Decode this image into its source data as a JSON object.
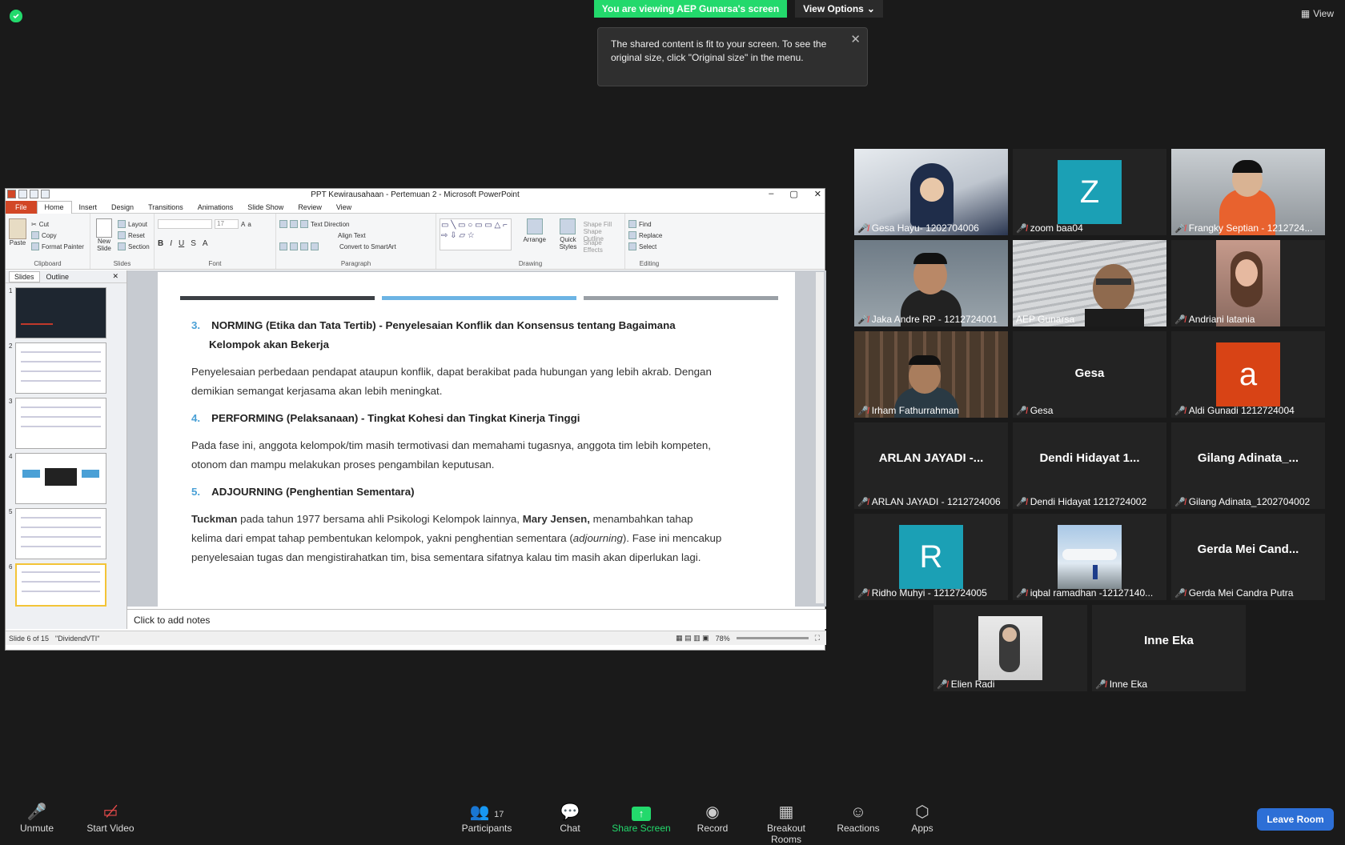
{
  "banner": {
    "viewing": "You are viewing AEP Gunarsa's screen",
    "view_options": "View Options"
  },
  "tooltip": {
    "text": "The shared content is fit to your screen. To see the original size, click \"Original size\" in the menu."
  },
  "top_right": {
    "view": "View"
  },
  "ppt": {
    "title": "PPT Kewirausahaan - Pertemuan 2  -  Microsoft PowerPoint",
    "tabs": [
      "File",
      "Home",
      "Insert",
      "Design",
      "Transitions",
      "Animations",
      "Slide Show",
      "Review",
      "View"
    ],
    "clipboard": {
      "paste": "Paste",
      "cut": "Cut",
      "copy": "Copy",
      "format_painter": "Format Painter",
      "label": "Clipboard"
    },
    "slides": {
      "new_slide": "New Slide",
      "layout": "Layout",
      "reset": "Reset",
      "section": "Section",
      "label": "Slides"
    },
    "font": {
      "size": "17",
      "label": "Font"
    },
    "paragraph": {
      "text_direction": "Text Direction",
      "align_text": "Align Text",
      "smartart": "Convert to SmartArt",
      "label": "Paragraph"
    },
    "drawing": {
      "arrange": "Arrange",
      "quick_styles": "Quick Styles",
      "shape_fill": "Shape Fill",
      "shape_outline": "Shape Outline",
      "shape_effects": "Shape Effects",
      "label": "Drawing"
    },
    "editing": {
      "find": "Find",
      "replace": "Replace",
      "select": "Select",
      "label": "Editing"
    },
    "pane_tabs": {
      "slides": "Slides",
      "outline": "Outline"
    },
    "thumb_numbers": [
      "1",
      "2",
      "3",
      "4",
      "5",
      "6"
    ],
    "notes_placeholder": "Click to add notes",
    "status": {
      "slide": "Slide 6 of 15",
      "theme": "\"DividendVTI\"",
      "zoom": "78%"
    }
  },
  "slide": {
    "norming_num": "3.",
    "norming_title": "NORMING (Etika dan Tata Tertib) - Penyelesaian Konflik dan Konsensus tentang Bagaimana",
    "norming_title2": "Kelompok akan Bekerja",
    "norming_body1": "Penyelesaian perbedaan pendapat ataupun konflik, dapat berakibat pada hubungan yang lebih akrab. Dengan",
    "norming_body2": "demikian semangat kerjasama akan lebih meningkat.",
    "performing_num": "4.",
    "performing_title": "PERFORMING (Pelaksanaan) - Tingkat Kohesi dan Tingkat Kinerja Tinggi",
    "performing_body1": "Pada fase ini, anggota kelompok/tim masih termotivasi dan memahami tugasnya, anggota tim lebih kompeten,",
    "performing_body2": "otonom dan mampu melakukan proses pengambilan keputusan.",
    "adjourning_num": "5.",
    "adjourning_title": "ADJOURNING (Penghentian Sementara)",
    "p_tuckman": "Tuckman",
    "p_a": " pada tahun 1977 bersama ahli Psikologi Kelompok lainnya, ",
    "p_mary": "Mary Jensen,",
    "p_b": " menambahkan tahap",
    "p_line2a": "kelima dari empat tahap pembentukan kelompok, yakni penghentian sementara (",
    "p_adj": "adjourning",
    "p_line2b": "). Fase ini mencakup",
    "p_line3": "penyelesaian tugas dan mengistirahatkan tim, bisa sementara sifatnya kalau tim masih akan diperlukan lagi."
  },
  "participants": [
    {
      "name": "Gesa Hayu- 1202704006"
    },
    {
      "name": "zoom baa04",
      "initial": "Z"
    },
    {
      "name": "Frangky Septian - 1212724..."
    },
    {
      "name": "Jaka Andre RP - 1212724001"
    },
    {
      "name": "AEP Gunarsa"
    },
    {
      "name": "Andriani latania"
    },
    {
      "name": "Irham Fathurrahman"
    },
    {
      "name": "Gesa",
      "display": "Gesa"
    },
    {
      "name": "Aldi Gunadi 1212724004",
      "initial": "a"
    },
    {
      "name": "ARLAN JAYADI - 1212724006",
      "display": "ARLAN JAYADI -..."
    },
    {
      "name": "Dendi Hidayat 1212724002",
      "display": "Dendi  Hidayat  1..."
    },
    {
      "name": "Gilang Adinata_1202704002",
      "display": "Gilang  Adinata_..."
    },
    {
      "name": "Ridho Muhyi - 1212724005",
      "initial": "R"
    },
    {
      "name": "iqbal ramadhan -12127140..."
    },
    {
      "name": "Gerda Mei Candra Putra",
      "display": "Gerda  Mei  Cand..."
    },
    {
      "name": "Elien Radi"
    },
    {
      "name": "Inne Eka",
      "display": "Inne Eka"
    }
  ],
  "toolbar": {
    "unmute": "Unmute",
    "start_video": "Start Video",
    "participants": "Participants",
    "participants_count": "17",
    "chat": "Chat",
    "share_screen": "Share Screen",
    "record": "Record",
    "breakout": "Breakout Rooms",
    "reactions": "Reactions",
    "apps": "Apps",
    "leave": "Leave Room"
  },
  "colors": {
    "zoom_green": "#23d96c",
    "leave_blue": "#2d6fd6",
    "speaker_outline": "#b7e35a",
    "teal_avatar": "#1ba0b5",
    "orange_avatar": "#d84315"
  }
}
